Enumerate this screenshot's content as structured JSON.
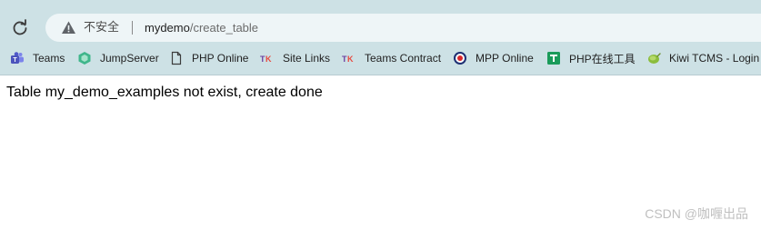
{
  "address_bar": {
    "security_label": "不安全",
    "url_host": "mydemo",
    "url_path": "/create_table"
  },
  "bookmarks": [
    {
      "label": "Teams",
      "icon": "teams-icon"
    },
    {
      "label": "JumpServer",
      "icon": "jumpserver-icon"
    },
    {
      "label": "PHP Online",
      "icon": "page-icon"
    },
    {
      "label": "Site Links",
      "icon": "tk-logo-icon"
    },
    {
      "label": "Teams Contract",
      "icon": "tk-logo-icon"
    },
    {
      "label": "MPP Online",
      "icon": "mpp-target-icon"
    },
    {
      "label": "PHP在线工具",
      "icon": "php-tool-icon"
    },
    {
      "label": "Kiwi TCMS - Login",
      "icon": "kiwi-icon"
    }
  ],
  "page": {
    "message": "Table my_demo_examples not exist, create done"
  },
  "watermark": {
    "text": "CSDN @咖喱出品"
  },
  "colors": {
    "toolbar_bg": "#cde1e5",
    "omnibox_bg": "#eef5f7",
    "teams_purple": "#5059c9",
    "jumpserver_green": "#3fb68b",
    "mpp_red": "#d9262b",
    "php_tool_green": "#1a9b5a"
  }
}
